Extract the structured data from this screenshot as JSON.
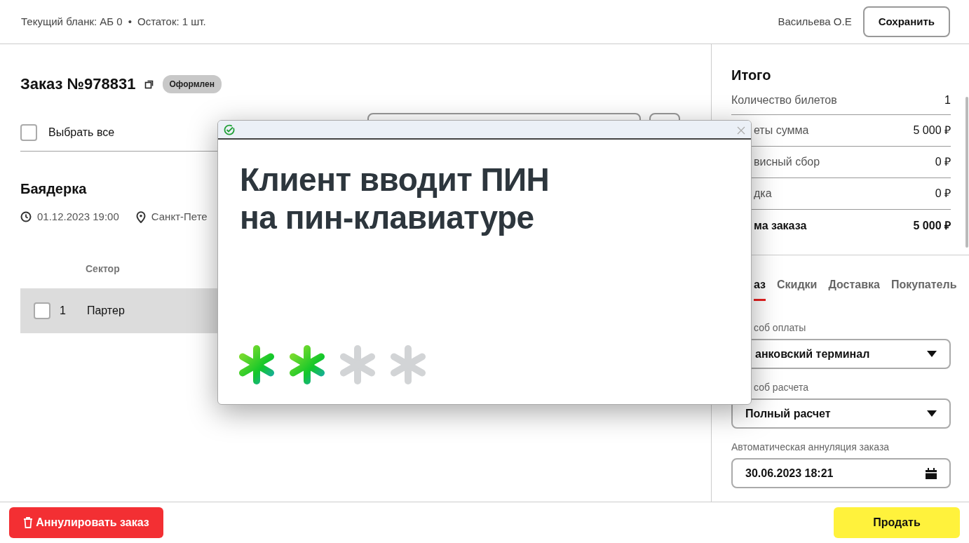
{
  "header": {
    "blank_info": "Текущий бланк: АБ 0",
    "separator": "•",
    "remaining": "Остаток: 1 шт.",
    "user": "Васильева О.Е",
    "save_button": "Сохранить"
  },
  "order": {
    "title": "Заказ №978831",
    "status": "Оформлен",
    "select_all": {
      "label": "Выбрать все",
      "checked": false
    }
  },
  "event": {
    "title": "Баядерка",
    "datetime": "01.12.2023 19:00",
    "place": "Санкт-Пете"
  },
  "table": {
    "columns": [
      "Сектор"
    ],
    "rows": [
      {
        "number": "1",
        "sector": "Партер",
        "checked": false
      }
    ]
  },
  "summary": {
    "title": "Итого",
    "rows": [
      {
        "label": "Количество билетов",
        "value": "1",
        "kind": "normal"
      },
      {
        "label": "еты сумма",
        "value": "5 000 ₽",
        "kind": "normal",
        "clipped": true
      },
      {
        "label": "висный сбор",
        "value": "0 ₽",
        "kind": "normal",
        "clipped": true
      },
      {
        "label": "дка",
        "value": "0 ₽",
        "kind": "normal",
        "clipped": true
      },
      {
        "label": "ма заказа",
        "value": "5 000 ₽",
        "kind": "total",
        "clipped": true
      }
    ]
  },
  "tabs": [
    {
      "label": "аз",
      "selected": true,
      "clipped": true
    },
    {
      "label": "Скидки",
      "selected": false
    },
    {
      "label": "Доставка",
      "selected": false
    },
    {
      "label": "Покупатель",
      "selected": false
    }
  ],
  "fields": [
    {
      "label": "соб оплаты",
      "value": "анковский терминал",
      "kind": "select",
      "label_clipped": true,
      "value_clipped": true
    },
    {
      "label": "соб расчета",
      "value": "Полный расчет",
      "kind": "select",
      "label_clipped": true
    },
    {
      "label": "Автоматическая аннуляция заказа",
      "value": "30.06.2023 18:21",
      "kind": "date"
    }
  ],
  "footer": {
    "cancel_button": "Аннулировать заказ",
    "sell_button": "Продать"
  },
  "modal": {
    "message": "Клиент вводит ПИН\nна пин-клавиатуре",
    "pin_marks": [
      {
        "entered": true
      },
      {
        "entered": true
      },
      {
        "entered": false
      },
      {
        "entered": false
      }
    ]
  }
}
